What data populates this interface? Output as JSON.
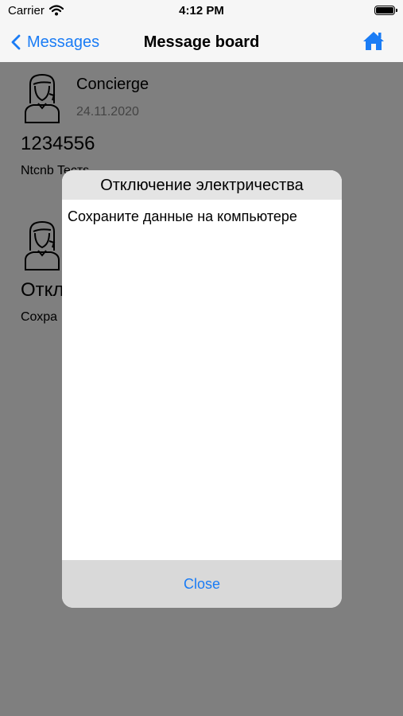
{
  "status_bar": {
    "carrier": "Carrier",
    "time": "4:12 PM"
  },
  "nav": {
    "back_label": "Messages",
    "title": "Message board"
  },
  "messages": [
    {
      "sender": "Concierge",
      "date": "24.11.2020",
      "title": "1234556",
      "body": "Ntcnb Tecтs"
    },
    {
      "sender": "",
      "date": "",
      "title": "Откл",
      "body": "Сохра"
    }
  ],
  "modal": {
    "title": "Отключение электричества",
    "body": "Сохраните данные на компьютере",
    "close_label": "Close"
  },
  "colors": {
    "accent": "#1a7cf5",
    "overlay": "#808080"
  }
}
